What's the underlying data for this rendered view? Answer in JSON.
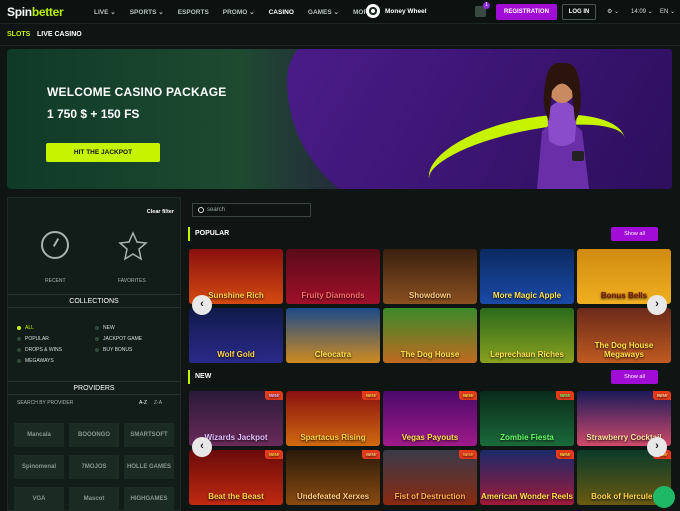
{
  "brand": {
    "part1": "Spin",
    "part2": "better"
  },
  "nav": [
    "LIVE",
    "SPORTS",
    "ESPORTS",
    "PROMO",
    "CASINO",
    "GAMES",
    "MORE"
  ],
  "nav_active": "CASINO",
  "money_wheel": "Money Wheel",
  "gift_count": "1",
  "header": {
    "registration": "REGISTRATION",
    "login": "LOG IN",
    "time": "14:09",
    "lang": "EN"
  },
  "subnav": [
    "SLOTS",
    "LIVE CASINO"
  ],
  "banner": {
    "title": "WELCOME CASINO PACKAGE",
    "amount": "1 750 $ + 150 FS",
    "cta": "HIT THE JACKPOT"
  },
  "sidebar": {
    "clear": "Clear filter",
    "recent": "RECENT",
    "favorites": "FAVORITES",
    "collections_title": "COLLECTIONS",
    "collections": [
      "ALL",
      "NEW",
      "POPULAR",
      "JACKPOT GAME",
      "DROPS & WINS",
      "BUY BONUS",
      "MEGAWAYS"
    ],
    "providers_title": "PROVIDERS",
    "search_by_provider": "SEARCH BY PROVIDER",
    "sort_az": "A-Z",
    "sort_za": "Z-A",
    "providers": [
      "Mancala",
      "BOOONGO",
      "SMARTSOFT",
      "Spinomenal",
      "7MOJOS",
      "HOLLE GAMES",
      "VGA",
      "Mascot",
      "HIGHGAMES"
    ]
  },
  "main": {
    "search_placeholder": "search",
    "popular": "POPULAR",
    "new": "NEW",
    "show_all": "Show all",
    "new_badge": "NEW",
    "popular_games": [
      "Sunshine Rich",
      "Fruity Diamonds",
      "Showdown",
      "More Magic Apple",
      "Bonus Bells",
      "Wolf Gold",
      "Cleocatra",
      "The Dog House",
      "Leprechaun Riches",
      "The Dog House Megaways"
    ],
    "new_games": [
      "Wizards Jackpot",
      "Spartacus Rising",
      "Vegas Payouts",
      "Zombie Fiesta",
      "Strawberry Cocktail",
      "Beat the Beast",
      "Undefeated Xerxes",
      "Fist of Destruction",
      "American Wonder Reels",
      "Book of Hercules"
    ]
  }
}
